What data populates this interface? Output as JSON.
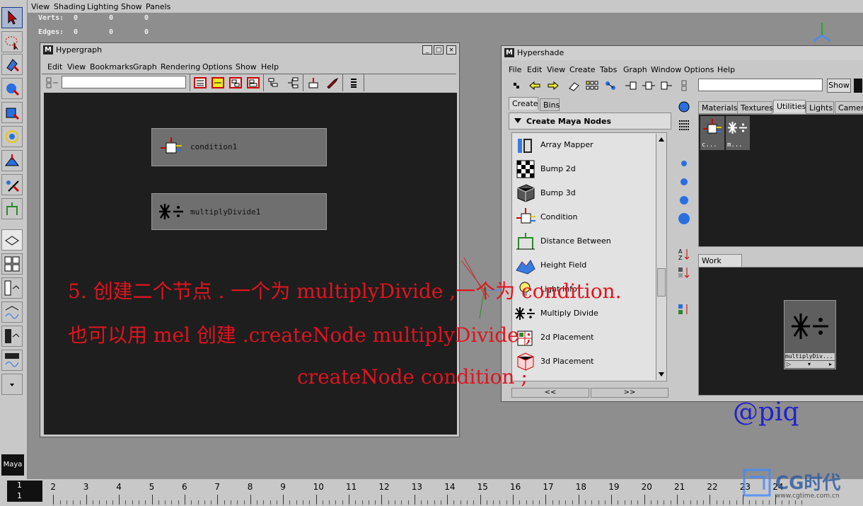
{
  "main_menu": [
    "View",
    "Shading",
    "Lighting",
    "Show",
    "Panels"
  ],
  "hud": {
    "verts_label": "Verts:",
    "edges_label": "Edges:",
    "verts": [
      "0",
      "0",
      "0"
    ],
    "edges": [
      "0",
      "0",
      "0"
    ]
  },
  "hypergraph": {
    "title": "Hypergraph",
    "menus": [
      "Edit",
      "View",
      "Bookmarks",
      "Graph",
      "Rendering",
      "Options",
      "Show",
      "Help"
    ],
    "nodes": [
      {
        "label": "condition1",
        "icon": "condition-node-icon"
      },
      {
        "label": "multiplyDivide1",
        "icon": "multiply-divide-node-icon"
      }
    ],
    "window_buttons": [
      "_",
      "□",
      "×"
    ]
  },
  "hypershade": {
    "title": "Hypershade",
    "menus": [
      "File",
      "Edit",
      "View",
      "Create",
      "Tabs",
      "Graph",
      "Window",
      "Options",
      "Help"
    ],
    "show_button": "Show",
    "create_tabs": [
      "Create",
      "Bins"
    ],
    "create_header": "Create Maya Nodes",
    "nodes_list": [
      {
        "label": "Array Mapper",
        "icon": "array-mapper-icon"
      },
      {
        "label": "Bump 2d",
        "icon": "bump-2d-icon"
      },
      {
        "label": "Bump 3d",
        "icon": "bump-3d-icon"
      },
      {
        "label": "Condition",
        "icon": "condition-icon"
      },
      {
        "label": "Distance Between",
        "icon": "distance-between-icon"
      },
      {
        "label": "Height Field",
        "icon": "height-field-icon"
      },
      {
        "label": "Light Info",
        "icon": "light-info-icon"
      },
      {
        "label": "Multiply Divide",
        "icon": "multiply-divide-icon"
      },
      {
        "label": "2d Placement",
        "icon": "2d-placement-icon"
      },
      {
        "label": "3d Placement",
        "icon": "3d-placement-icon"
      }
    ],
    "scroll_left": "<<",
    "scroll_right": ">>",
    "top_tabs": [
      "Materials",
      "Textures",
      "Utilities",
      "Lights",
      "Camera"
    ],
    "utility_swatches": [
      "c...",
      "m..."
    ],
    "work_area_tab": "Work Area",
    "work_area_node": "multiplyDiv..."
  },
  "overlay": {
    "line1": "5. 创建二个节点 . 一个为 multiplyDivide ,一个为 condition.",
    "line2": "也可以用 mel 创建 .createNode multiplyDivide ;",
    "line3": "createNode condition ;",
    "signature": "@piq",
    "color": "#e0141e",
    "signature_color": "#2222cc"
  },
  "timeline": {
    "current_frame": "1",
    "current_frame_sub": "1",
    "ticks": [
      "1",
      "2",
      "3",
      "4",
      "5",
      "6",
      "7",
      "8",
      "9",
      "10",
      "11",
      "12",
      "13",
      "14",
      "15",
      "16",
      "17",
      "18",
      "19",
      "20",
      "21",
      "22",
      "23",
      "24"
    ]
  },
  "watermark": {
    "text": "CG时代",
    "url": "www.cgtime.com.cn"
  },
  "logo": "Maya"
}
